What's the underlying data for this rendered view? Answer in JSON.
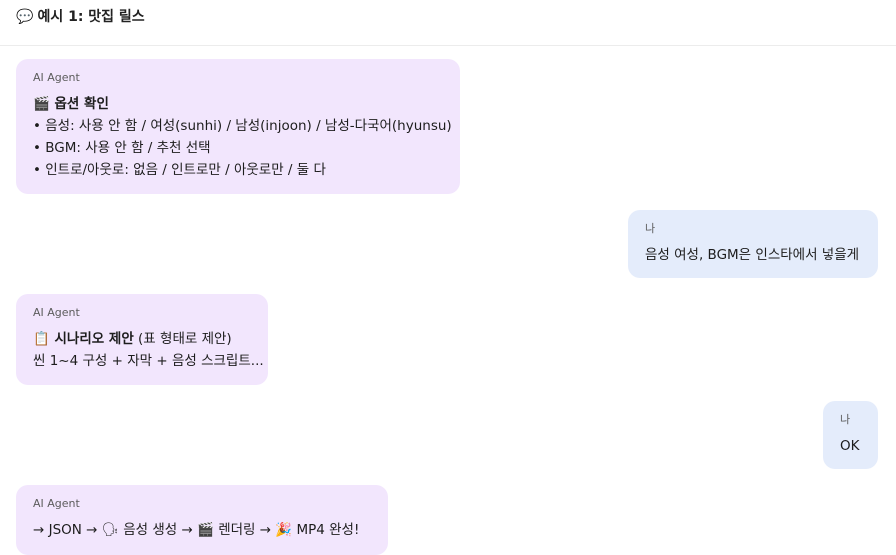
{
  "header": {
    "icon": "speech-bubble-icon",
    "icon_glyph": "💬",
    "title": "예시 1: 맛집 릴스"
  },
  "messages": [
    {
      "sender": "AI Agent",
      "role": "agent",
      "title_glyph": "🎬",
      "title": "옵션 확인",
      "lines": [
        "• 음성: 사용 안 함 / 여성(sunhi) / 남성(injoon) / 남성-다국어(hyunsu)",
        "• BGM: 사용 안 함 / 추천 선택",
        "• 인트로/아웃로: 없음 / 인트로만 / 아웃로만 / 둘 다"
      ]
    },
    {
      "sender": "나",
      "role": "me",
      "lines": [
        "음성 여성, BGM은 인스타에서 넣을게"
      ]
    },
    {
      "sender": "AI Agent",
      "role": "agent",
      "title_glyph": "📋",
      "title": "시나리오 제안",
      "title_suffix": " (표 형태로 제안)",
      "lines": [
        "씬 1~4 구성 + 자막 + 음성 스크립트..."
      ]
    },
    {
      "sender": "나",
      "role": "me",
      "lines": [
        "OK"
      ]
    },
    {
      "sender": "AI Agent",
      "role": "agent",
      "flow": {
        "p1": "→ JSON → ",
        "g1": "🗣",
        "p2": " 음성 생성 → ",
        "g2": "🎬",
        "p3": " 렌더링 → ",
        "g3": "🎉",
        "p4": " MP4 완성!"
      }
    }
  ]
}
